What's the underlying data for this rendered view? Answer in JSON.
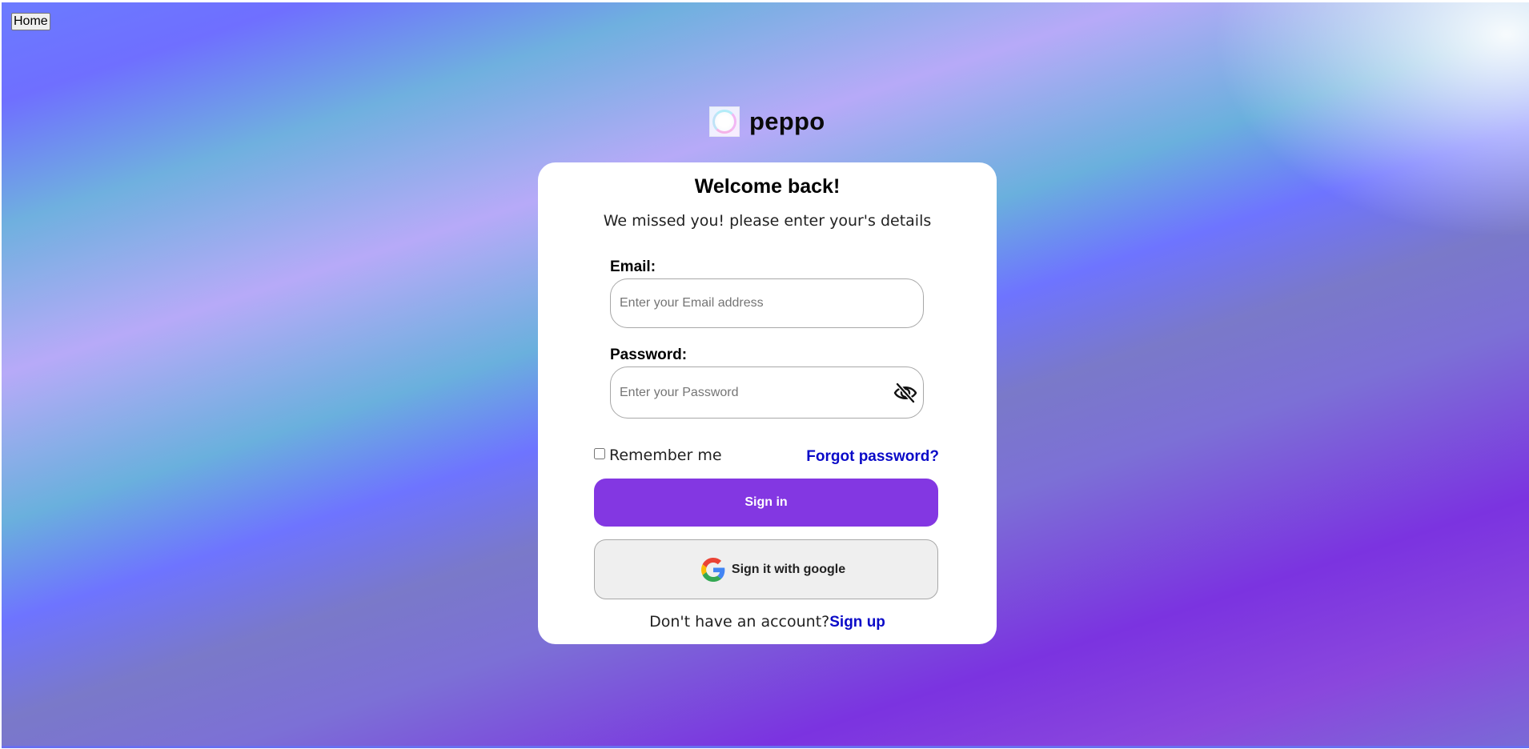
{
  "nav": {
    "home_label": "Home"
  },
  "brand": {
    "name": "peppo",
    "logo_icon": "peppo-logo-icon"
  },
  "login": {
    "title": "Welcome back!",
    "subtitle": "We missed you! please enter your's details",
    "email": {
      "label": "Email:",
      "value": "",
      "placeholder": "Enter your Email address"
    },
    "password": {
      "label": "Password:",
      "value": "",
      "placeholder": "Enter your Password",
      "toggle_icon": "eye-slash-icon"
    },
    "remember_me": {
      "label": "Remember me",
      "checked": false
    },
    "forgot_password_label": "Forgot password?",
    "sign_in_label": "Sign in",
    "google_button_label": "Sign it with google",
    "google_icon": "google-icon",
    "no_account_text": "Don't have an account?",
    "sign_up_label": "Sign up"
  },
  "colors": {
    "primary_button": "#8337e2",
    "link": "#0a0ac8",
    "card_background": "#ffffff"
  }
}
